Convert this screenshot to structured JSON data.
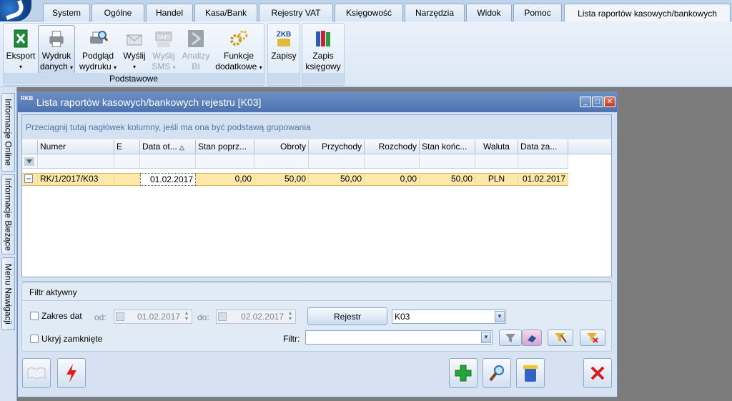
{
  "tabs": [
    "System",
    "Ogólne",
    "Handel",
    "Kasa/Bank",
    "Rejestry VAT",
    "Księgowość",
    "Narzędzia",
    "Widok",
    "Pomoc",
    "Lista raportów kasowych/bankowych"
  ],
  "ribbon": {
    "eksport": "Eksport",
    "wydruk_1": "Wydruk",
    "wydruk_2": "danych",
    "podglad_1": "Podgląd",
    "podglad_2": "wydruku",
    "wyslij": "Wyślij",
    "wyslij_sms_1": "Wyślij",
    "wyslij_sms_2": "SMS",
    "sms_badge": "SMS",
    "analizy_1": "Analizy",
    "analizy_2": "BI",
    "funkcje_1": "Funkcje",
    "funkcje_2": "dodatkowe",
    "group_podstawowe": "Podstawowe",
    "zkb_badge": "ZKB",
    "zapisy": "Zapisy",
    "zapis_1": "Zapis",
    "zapis_2": "księgowy"
  },
  "side_tabs": [
    "Informacje Online",
    "Informacje Bieżące",
    "Menu Nawigacji"
  ],
  "window": {
    "icon_text": "RKB",
    "title": "Lista raportów kasowych/bankowych rejestru [K03]",
    "group_hint": "Przeciągnij tutaj nagłówek kolumny, jeśli ma ona być podstawą grupowania"
  },
  "grid": {
    "columns": [
      "Numer",
      "E",
      "Data ot...",
      "Stan poprz...",
      "Obroty",
      "Przychody",
      "Rozchody",
      "Stan końc...",
      "Waluta",
      "Data za..."
    ],
    "sort_indicator": "△",
    "rows": [
      {
        "numer": "RK/1/2017/K03",
        "e": "",
        "data_ot": "01.02.2017",
        "stan_poprz": "0,00",
        "obroty": "50,00",
        "przychody": "50,00",
        "rozchody": "0,00",
        "stan_konc": "50,00",
        "waluta": "PLN",
        "data_za": "01.02.2017"
      }
    ],
    "footer_count": "1"
  },
  "filter": {
    "title": "Filtr aktywny",
    "zakres_dat": "Zakres dat",
    "od_label": "od:",
    "od_value": "01.02.2017",
    "do_label": "do:",
    "do_value": "02.02.2017",
    "rejestr_button": "Rejestr",
    "rejestr_value": "K03",
    "ukryj": "Ukryj zamknięte",
    "filtr_label": "Filtr:",
    "filtr_value": ""
  },
  "colors": {
    "selected_row": "#fce9a9",
    "title_bar": "#5a7dbb"
  }
}
